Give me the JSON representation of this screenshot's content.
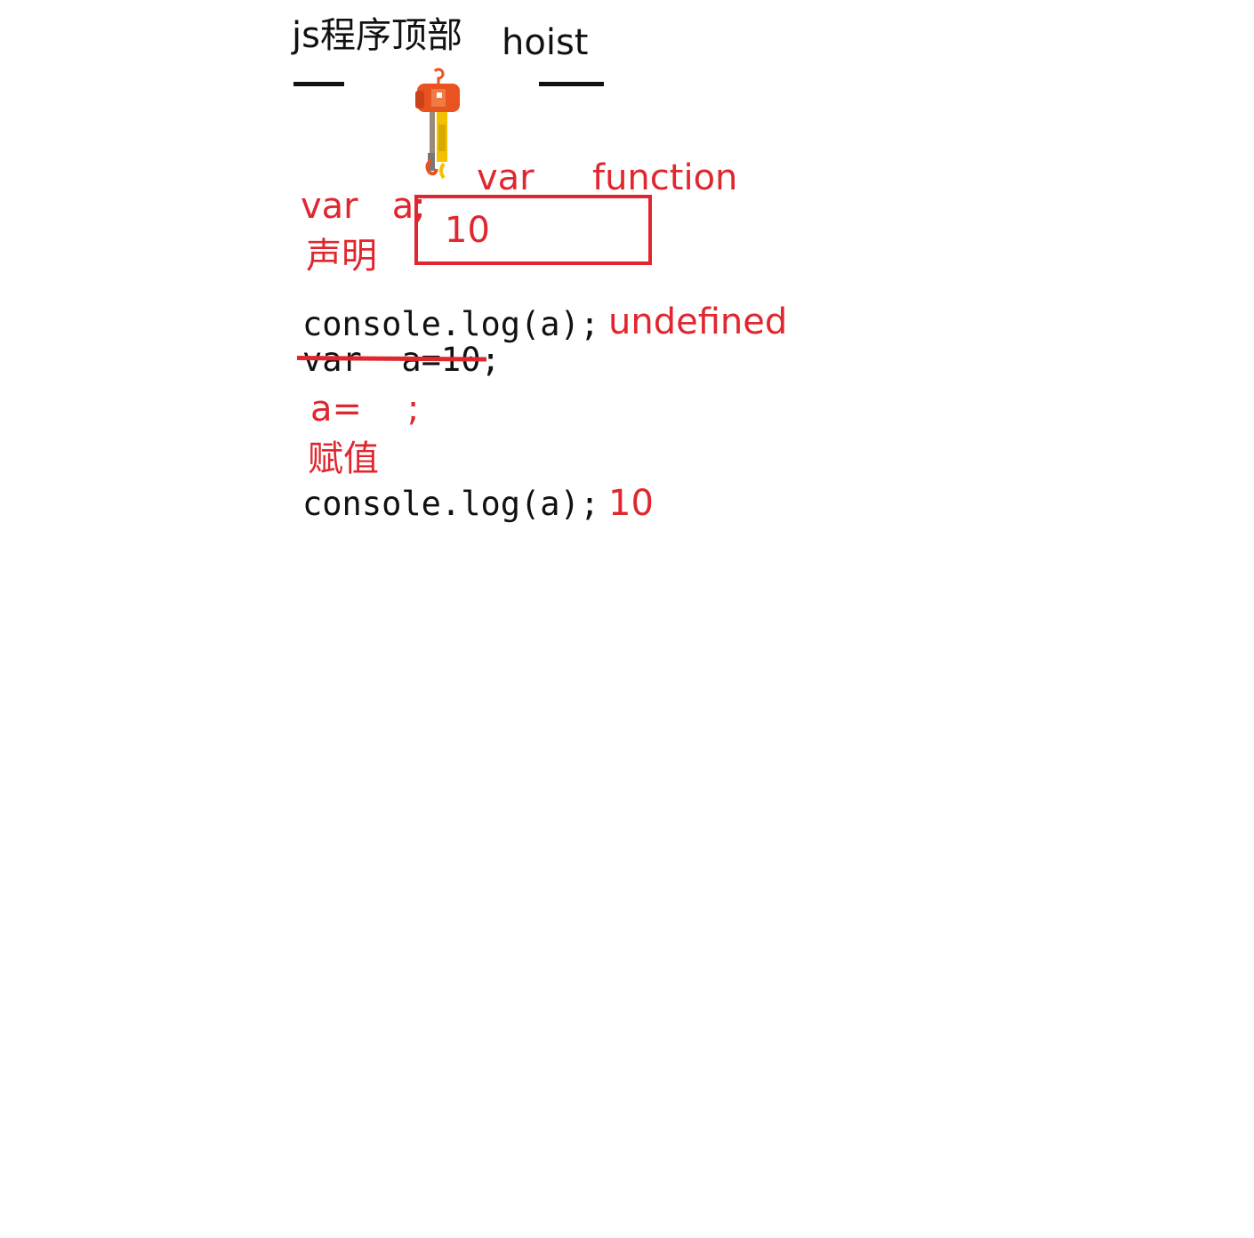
{
  "title": {
    "program_top": "js程序顶部",
    "hoist": "hoist"
  },
  "hoist_box": {
    "label_var": "var",
    "label_function": "function",
    "content": "10"
  },
  "declaration": {
    "code": "var   a;",
    "label": "声明"
  },
  "lines": {
    "log1_code": "console.log(a);",
    "log1_result": "undefined",
    "struck_code": "var  a=10;",
    "assign_code": "a=    ;",
    "assign_label": "赋值",
    "log2_code": "console.log(a);",
    "log2_result": "10"
  },
  "colors": {
    "annotation": "#e0262e",
    "text": "#111111",
    "hoist_body": "#e8531f",
    "hoist_hook": "#f2c200"
  },
  "icons": {
    "hoist": "electric-chain-hoist-icon"
  }
}
